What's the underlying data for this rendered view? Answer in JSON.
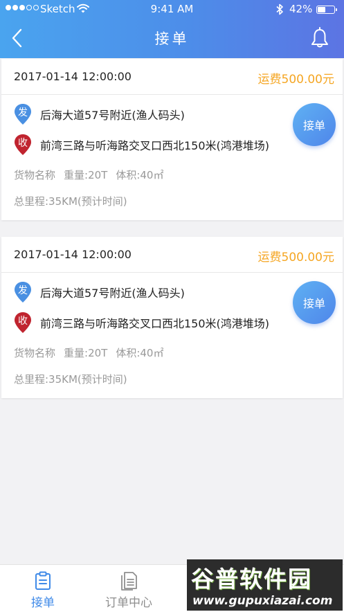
{
  "status_bar": {
    "carrier": "Sketch",
    "time": "9:41 AM",
    "battery": "42%"
  },
  "nav": {
    "title": "接单"
  },
  "orders": [
    {
      "datetime": "2017-01-14 12:00:00",
      "fee": "运费500.00元",
      "from_badge": "发",
      "from": "后海大道57号附近(渔人码头)",
      "to_badge": "收",
      "to": "前湾三路与听海路交叉口西北150米(鸿港堆场)",
      "cargo_name": "货物名称",
      "weight": "重量:20T",
      "volume": "体积:40㎡",
      "distance": "总里程:35KM(预计时间)",
      "accept_label": "接单"
    },
    {
      "datetime": "2017-01-14 12:00:00",
      "fee": "运费500.00元",
      "from_badge": "发",
      "from": "后海大道57号附近(渔人码头)",
      "to_badge": "收",
      "to": "前湾三路与听海路交叉口西北150米(鸿港堆场)",
      "cargo_name": "货物名称",
      "weight": "重量:20T",
      "volume": "体积:40㎡",
      "distance": "总里程:35KM(预计时间)",
      "accept_label": "接单"
    }
  ],
  "tabbar": {
    "tabs": [
      {
        "label": "接单",
        "icon": "clipboard-icon",
        "active": true
      },
      {
        "label": "订单中心",
        "icon": "document-list-icon",
        "active": false
      }
    ]
  },
  "watermark": {
    "text": "谷普软件园",
    "url": "www.gupuxiazai.com"
  },
  "colors": {
    "header_start": "#4aa4ef",
    "header_end": "#5c74e3",
    "fee": "#f5a623",
    "from_pin": "#4a90e2",
    "to_pin": "#c0242f",
    "active_tab": "#3f8ae8",
    "inactive_tab": "#8e8e8e"
  }
}
